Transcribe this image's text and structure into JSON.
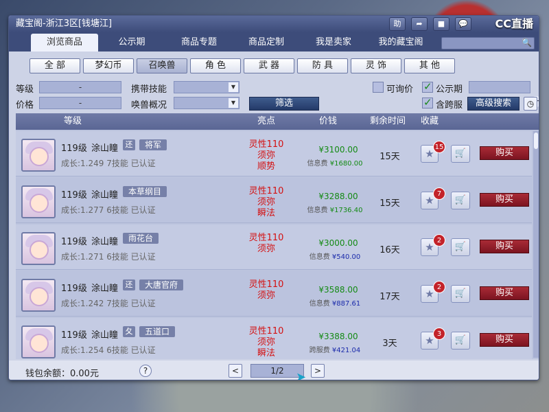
{
  "window": {
    "title": "藏宝阁-浙江3区[钱塘江]",
    "logo": "CC直播",
    "title_buttons": [
      "助",
      "➦",
      "■",
      "💬"
    ]
  },
  "tabs": [
    "浏览商品",
    "公示期",
    "商品专题",
    "商品定制",
    "我是卖家",
    "我的藏宝阁"
  ],
  "search": {
    "placeholder": ""
  },
  "categories": [
    "全 部",
    "梦幻币",
    "召唤兽",
    "角 色",
    "武 器",
    "防 具",
    "灵 饰",
    "其 他"
  ],
  "active_category": "召唤兽",
  "filters": {
    "level_label": "等级",
    "level_value": "-",
    "price_label": "价格",
    "price_value": "-",
    "skill_label": "携带技能",
    "pet_label": "唤兽概况",
    "filter_button": "筛选",
    "ask_price_label": "可询价",
    "notice_label": "公示期",
    "cross_server_label": "含跨服",
    "advanced_search": "高级搜索"
  },
  "table_headers": {
    "level": "等级",
    "highlights": "亮点",
    "price": "价钱",
    "time_left": "剩余时间",
    "favorite": "收藏"
  },
  "listings": [
    {
      "level": "119级",
      "name": "涂山瞳",
      "huan": "还",
      "skill_tag": "将军",
      "growth": "成长:1.249 7技能 已认证",
      "highlights": [
        "灵性110",
        "须弥",
        "顺势"
      ],
      "price": "¥3100.00",
      "fee_label": "信息费",
      "fee": "¥1680.00",
      "fee_blue": false,
      "days": "15天",
      "fav_count": "15",
      "buy": "购买"
    },
    {
      "level": "119级",
      "name": "涂山瞳",
      "huan": "",
      "skill_tag": "本草纲目",
      "growth": "成长:1.277 6技能 已认证",
      "highlights": [
        "灵性110",
        "须弥",
        "瞬法"
      ],
      "price": "¥3288.00",
      "fee_label": "信息费",
      "fee": "¥1736.40",
      "fee_blue": false,
      "days": "15天",
      "fav_count": "7",
      "buy": "购买"
    },
    {
      "level": "119级",
      "name": "涂山瞳",
      "huan": "",
      "skill_tag": "雨花台",
      "growth": "成长:1.271 6技能 已认证",
      "highlights": [
        "灵性110",
        "须弥"
      ],
      "price": "¥3000.00",
      "fee_label": "信息费",
      "fee": "¥540.00",
      "fee_blue": true,
      "days": "16天",
      "fav_count": "2",
      "buy": "购买"
    },
    {
      "level": "119级",
      "name": "涂山瞳",
      "huan": "还",
      "skill_tag": "大唐官府",
      "growth": "成长:1.242 7技能 已认证",
      "highlights": [
        "灵性110",
        "须弥"
      ],
      "price": "¥3588.00",
      "fee_label": "信息费",
      "fee": "¥887.61",
      "fee_blue": true,
      "days": "17天",
      "fav_count": "2",
      "buy": "购买"
    },
    {
      "level": "119级",
      "name": "涂山瞳",
      "huan": "夂",
      "skill_tag": "五道口",
      "growth": "成长:1.254 6技能 已认证",
      "highlights": [
        "灵性110",
        "须弥",
        "瞬法"
      ],
      "price": "¥3388.00",
      "fee_label": "跨服费",
      "fee": "¥421.04",
      "fee_blue": true,
      "days": "3天",
      "fav_count": "3",
      "buy": "购买"
    }
  ],
  "footer": {
    "wallet_label": "钱包余额：0.00元",
    "help": "?",
    "page": "1/2",
    "prev": "<",
    "next": ">"
  },
  "colors": {
    "accent": "#3d4c7a",
    "buy": "#a92b36",
    "highlight": "#d41010",
    "price": "#138a13"
  }
}
